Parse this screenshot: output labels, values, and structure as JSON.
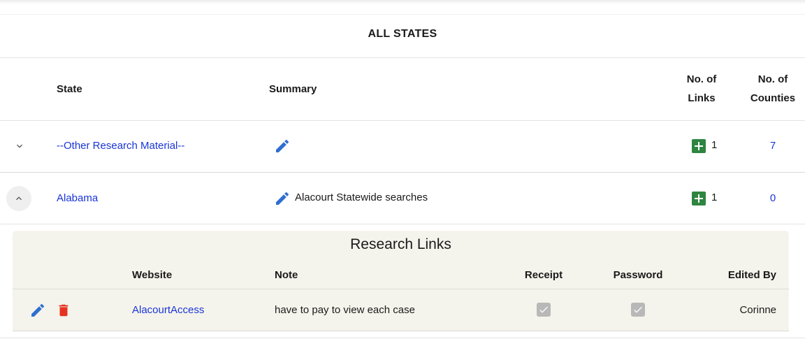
{
  "page": {
    "title": "ALL STATES"
  },
  "table": {
    "headers": {
      "state": "State",
      "summary": "Summary",
      "links_line1": "No. of",
      "links_line2": "Links",
      "counties_line1": "No. of",
      "counties_line2": "Counties"
    },
    "rows": [
      {
        "state": "--Other Research Material--",
        "summary": "",
        "links": "1",
        "counties": "7",
        "expanded": false
      },
      {
        "state": "Alabama",
        "summary": "Alacourt Statewide searches",
        "links": "1",
        "counties": "0",
        "expanded": true
      }
    ]
  },
  "research_links": {
    "title": "Research Links",
    "headers": {
      "website": "Website",
      "note": "Note",
      "receipt": "Receipt",
      "password": "Password",
      "edited_by": "Edited By"
    },
    "rows": [
      {
        "website": "AlacourtAccess",
        "note": "have to pay to view each case",
        "receipt": true,
        "password": true,
        "edited_by": "Corinne"
      }
    ]
  },
  "icons": {
    "expand": "chevron-down-icon",
    "collapse": "chevron-up-icon",
    "edit": "pencil-icon",
    "add": "plus-icon",
    "delete": "trash-icon",
    "checkbox": "checkbox-checked-icon"
  },
  "colors": {
    "link": "#1a35d6",
    "edit_icon": "#2f6fcf",
    "add_icon": "#2e8540",
    "delete_icon": "#e53322",
    "panel_bg": "#f5f4ec",
    "checkbox": "#b8b8b8"
  }
}
